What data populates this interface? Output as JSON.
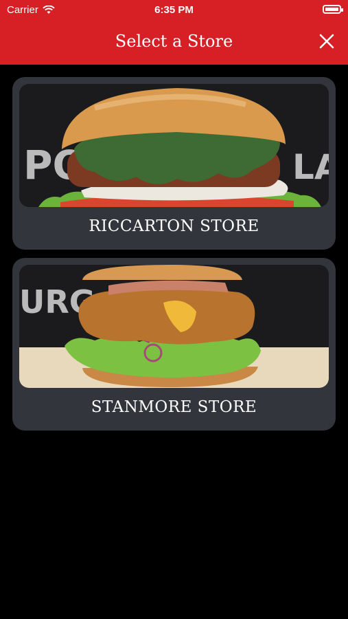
{
  "status_bar": {
    "carrier": "Carrier",
    "time": "6:35 PM"
  },
  "header": {
    "title": "Select a Store"
  },
  "stores": [
    {
      "label": "RICCARTON STORE",
      "bg_text": "PO    LA"
    },
    {
      "label": "STANMORE STORE",
      "bg_text": "URG"
    }
  ],
  "colors": {
    "header": "#d71f26",
    "card": "#32353c",
    "background": "#000000"
  }
}
